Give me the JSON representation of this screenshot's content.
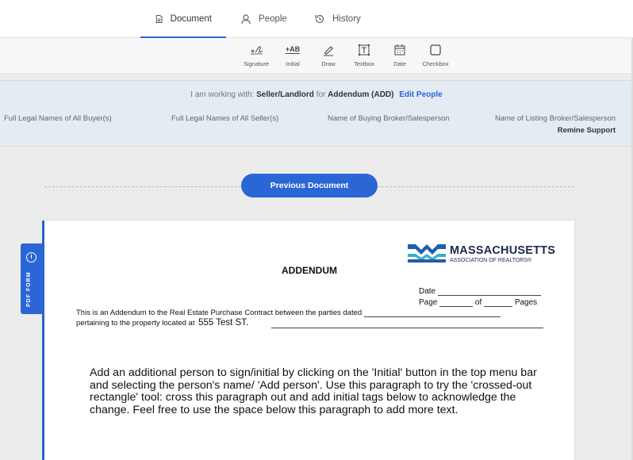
{
  "tabs": [
    {
      "label": "Document",
      "icon": "document-icon",
      "active": true
    },
    {
      "label": "People",
      "icon": "person-icon"
    },
    {
      "label": "History",
      "icon": "history-icon"
    }
  ],
  "tools": [
    {
      "label": "Signature",
      "icon": "signature-icon"
    },
    {
      "label": "Initial",
      "icon": "initial-icon",
      "glyph": "+AB"
    },
    {
      "label": "Draw",
      "icon": "pen-icon"
    },
    {
      "label": "Textbox",
      "icon": "textbox-icon"
    },
    {
      "label": "Date",
      "icon": "calendar-icon"
    },
    {
      "label": "Checkbox",
      "icon": "checkbox-icon"
    }
  ],
  "info": {
    "prefix": "I am working with:",
    "role": "Seller/Landlord",
    "for_word": "for",
    "doc_name": "Addendum (ADD)",
    "edit_label": "Edit People"
  },
  "parties": [
    {
      "label": "Full Legal Names of All Buyer(s)",
      "value": ""
    },
    {
      "label": "Full Legal Names of All Seller(s)",
      "value": ""
    },
    {
      "label": "Name of Buying Broker/Salesperson",
      "value": ""
    },
    {
      "label": "Name of Listing Broker/Salesperson",
      "value": "Remine Support"
    }
  ],
  "prev_button": "Previous Document",
  "pdf_tab": {
    "label": "PDF FORM",
    "icon_glyph": "i"
  },
  "document": {
    "logo_title": "MASSACHUSETTS",
    "logo_subtitle": "ASSOCIATION OF REALTORS®",
    "title": "ADDENDUM",
    "date_label": "Date",
    "page_label": "Page",
    "of_label": "of",
    "pages_label": "Pages",
    "line1": "This is an Addendum to the Real Estate Purchase Contract between the parties dated",
    "line2": "pertaining to the property located at",
    "address": "555 Test ST.",
    "paragraph": "Add an additional person to sign/initial by clicking on the 'Initial' button in the top menu bar and selecting the person's name/ 'Add person'. Use this paragraph to try the 'crossed-out rectangle' tool: cross this paragraph out and add initial tags below to acknowledge the change. Feel free to use the space below this paragraph to add more text."
  },
  "colors": {
    "accent": "#2b66d6",
    "info_bg": "#e4ebf2",
    "logo_blue": "#1f5fa8",
    "logo_teal": "#3ab0c8"
  }
}
